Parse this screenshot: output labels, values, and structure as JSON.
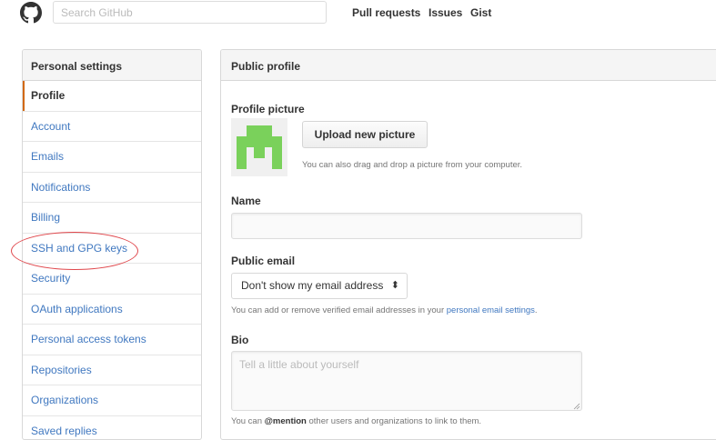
{
  "header": {
    "logo_icon": "github-octocat-icon",
    "search_placeholder": "Search GitHub",
    "nav": [
      "Pull requests",
      "Issues",
      "Gist"
    ]
  },
  "sidebar": {
    "title": "Personal settings",
    "items": [
      {
        "label": "Profile",
        "selected": true
      },
      {
        "label": "Account"
      },
      {
        "label": "Emails"
      },
      {
        "label": "Notifications"
      },
      {
        "label": "Billing"
      },
      {
        "label": "SSH and GPG keys",
        "annotated": true
      },
      {
        "label": "Security"
      },
      {
        "label": "OAuth applications"
      },
      {
        "label": "Personal access tokens"
      },
      {
        "label": "Repositories"
      },
      {
        "label": "Organizations"
      },
      {
        "label": "Saved replies"
      }
    ],
    "accent_color": "#d26911",
    "link_color": "#4078c0",
    "annotation_color": "#e0474c"
  },
  "profile": {
    "panel_title": "Public profile",
    "picture_label": "Profile picture",
    "avatar_color": "#7ad15b",
    "upload_label": "Upload new picture",
    "upload_hint": "You can also drag and drop a picture from your computer.",
    "name_label": "Name",
    "name_value": "",
    "email_label": "Public email",
    "email_selected": "Don't show my email address",
    "email_hint_prefix": "You can add or remove verified email addresses in your ",
    "email_hint_link": "personal email settings",
    "email_hint_suffix": ".",
    "bio_label": "Bio",
    "bio_placeholder": "Tell a little about yourself",
    "bio_hint_prefix": "You can ",
    "bio_hint_mention": "@mention",
    "bio_hint_suffix": " other users and organizations to link to them."
  }
}
